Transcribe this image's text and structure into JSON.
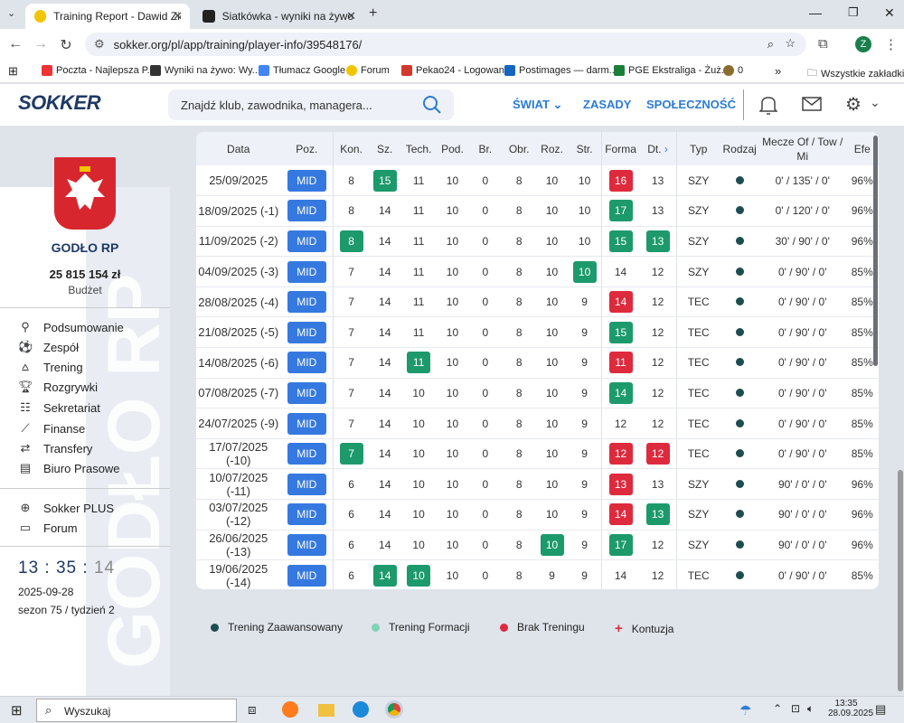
{
  "browser": {
    "tabs": [
      {
        "label": "Training Report - Dawid Ziemiar",
        "active": true
      },
      {
        "label": "Siatkówka - wyniki na żywo, wyn",
        "active": false
      }
    ],
    "url": "sokker.org/pl/app/training/player-info/39548176/",
    "bookmarks": [
      "Poczta - Najlepsza P...",
      "Wyniki na żywo: Wy...",
      "Tłumacz Google",
      "Forum",
      "Pekao24 - Logowanie",
      "Postimages — darm...",
      "PGE Ekstraliga - Żuż...",
      "0",
      "Wszystkie zakładki"
    ],
    "profile_initial": "Z"
  },
  "header": {
    "logo": "SOKKER",
    "search_placeholder": "Znajdź klub, zawodnika, managera...",
    "nav": [
      "ŚWIAT",
      "ZASADY",
      "SPOŁECZNOŚĆ"
    ]
  },
  "sidebar": {
    "club_name": "GODŁO RP",
    "budget": "25 815 154 zł",
    "budget_label": "Budżet",
    "menu": [
      "Podsumowanie",
      "Zespół",
      "Trening",
      "Rozgrywki",
      "Sekretariat",
      "Finanse",
      "Transfery",
      "Biuro Prasowe"
    ],
    "menu2": [
      "Sokker PLUS",
      "Forum"
    ],
    "clock": {
      "h": "13",
      "m": "35",
      "s": "14"
    },
    "date": "2025-09-28",
    "season": "sezon 75 / tydzień 2",
    "watermark": "GODŁO RP"
  },
  "table": {
    "headers": [
      "Data",
      "Poz.",
      "Kon.",
      "Sz.",
      "Tech.",
      "Pod.",
      "Br.",
      "Obr.",
      "Roz.",
      "Str.",
      "Forma",
      "Dt.",
      "Typ",
      "Rodzaj",
      "Mecze Of / Tow / Mi",
      "Efe"
    ],
    "rows": [
      {
        "date": "25/09/2025",
        "pos": "MID",
        "kon": "8",
        "sz": "15",
        "tech": "11",
        "pod": "10",
        "br": "0",
        "obr": "8",
        "roz": "10",
        "str": "10",
        "forma": "16",
        "dt": "13",
        "typ": "SZY",
        "mecze": "0' / 135' / 0'",
        "efe": "96%",
        "hl": {
          "sz": "g",
          "forma": "r"
        }
      },
      {
        "date": "18/09/2025 (-1)",
        "pos": "MID",
        "kon": "8",
        "sz": "14",
        "tech": "11",
        "pod": "10",
        "br": "0",
        "obr": "8",
        "roz": "10",
        "str": "10",
        "forma": "17",
        "dt": "13",
        "typ": "SZY",
        "mecze": "0' / 120' / 0'",
        "efe": "96%",
        "hl": {
          "forma": "g"
        }
      },
      {
        "date": "11/09/2025 (-2)",
        "pos": "MID",
        "kon": "8",
        "sz": "14",
        "tech": "11",
        "pod": "10",
        "br": "0",
        "obr": "8",
        "roz": "10",
        "str": "10",
        "forma": "15",
        "dt": "13",
        "typ": "SZY",
        "mecze": "30' / 90' / 0'",
        "efe": "96%",
        "hl": {
          "kon": "g",
          "forma": "g",
          "dt": "g"
        }
      },
      {
        "date": "04/09/2025 (-3)",
        "pos": "MID",
        "kon": "7",
        "sz": "14",
        "tech": "11",
        "pod": "10",
        "br": "0",
        "obr": "8",
        "roz": "10",
        "str": "10",
        "forma": "14",
        "dt": "12",
        "typ": "SZY",
        "mecze": "0' / 90' / 0'",
        "efe": "85%",
        "hl": {
          "str": "g"
        }
      },
      {
        "date": "28/08/2025 (-4)",
        "pos": "MID",
        "kon": "7",
        "sz": "14",
        "tech": "11",
        "pod": "10",
        "br": "0",
        "obr": "8",
        "roz": "10",
        "str": "9",
        "forma": "14",
        "dt": "12",
        "typ": "TEC",
        "mecze": "0' / 90' / 0'",
        "efe": "85%",
        "hl": {
          "forma": "r"
        }
      },
      {
        "date": "21/08/2025 (-5)",
        "pos": "MID",
        "kon": "7",
        "sz": "14",
        "tech": "11",
        "pod": "10",
        "br": "0",
        "obr": "8",
        "roz": "10",
        "str": "9",
        "forma": "15",
        "dt": "12",
        "typ": "TEC",
        "mecze": "0' / 90' / 0'",
        "efe": "85%",
        "hl": {
          "forma": "g"
        }
      },
      {
        "date": "14/08/2025 (-6)",
        "pos": "MID",
        "kon": "7",
        "sz": "14",
        "tech": "11",
        "pod": "10",
        "br": "0",
        "obr": "8",
        "roz": "10",
        "str": "9",
        "forma": "11",
        "dt": "12",
        "typ": "TEC",
        "mecze": "0' / 90' / 0'",
        "efe": "85%",
        "hl": {
          "tech": "g",
          "forma": "r"
        }
      },
      {
        "date": "07/08/2025 (-7)",
        "pos": "MID",
        "kon": "7",
        "sz": "14",
        "tech": "10",
        "pod": "10",
        "br": "0",
        "obr": "8",
        "roz": "10",
        "str": "9",
        "forma": "14",
        "dt": "12",
        "typ": "TEC",
        "mecze": "0' / 90' / 0'",
        "efe": "85%",
        "hl": {
          "forma": "g"
        }
      },
      {
        "date": "24/07/2025 (-9)",
        "pos": "MID",
        "kon": "7",
        "sz": "14",
        "tech": "10",
        "pod": "10",
        "br": "0",
        "obr": "8",
        "roz": "10",
        "str": "9",
        "forma": "12",
        "dt": "12",
        "typ": "TEC",
        "mecze": "0' / 90' / 0'",
        "efe": "85%",
        "hl": {}
      },
      {
        "date": "17/07/2025 (-10)",
        "pos": "MID",
        "kon": "7",
        "sz": "14",
        "tech": "10",
        "pod": "10",
        "br": "0",
        "obr": "8",
        "roz": "10",
        "str": "9",
        "forma": "12",
        "dt": "12",
        "typ": "TEC",
        "mecze": "0' / 90' / 0'",
        "efe": "85%",
        "hl": {
          "kon": "g",
          "forma": "r",
          "dt": "r"
        }
      },
      {
        "date": "10/07/2025 (-11)",
        "pos": "MID",
        "kon": "6",
        "sz": "14",
        "tech": "10",
        "pod": "10",
        "br": "0",
        "obr": "8",
        "roz": "10",
        "str": "9",
        "forma": "13",
        "dt": "13",
        "typ": "SZY",
        "mecze": "90' / 0' / 0'",
        "efe": "96%",
        "hl": {
          "forma": "r"
        }
      },
      {
        "date": "03/07/2025 (-12)",
        "pos": "MID",
        "kon": "6",
        "sz": "14",
        "tech": "10",
        "pod": "10",
        "br": "0",
        "obr": "8",
        "roz": "10",
        "str": "9",
        "forma": "14",
        "dt": "13",
        "typ": "SZY",
        "mecze": "90' / 0' / 0'",
        "efe": "96%",
        "hl": {
          "forma": "r",
          "dt": "g"
        }
      },
      {
        "date": "26/06/2025 (-13)",
        "pos": "MID",
        "kon": "6",
        "sz": "14",
        "tech": "10",
        "pod": "10",
        "br": "0",
        "obr": "8",
        "roz": "10",
        "str": "9",
        "forma": "17",
        "dt": "12",
        "typ": "SZY",
        "mecze": "90' / 0' / 0'",
        "efe": "96%",
        "hl": {
          "roz": "g",
          "forma": "g"
        }
      },
      {
        "date": "19/06/2025 (-14)",
        "pos": "MID",
        "kon": "6",
        "sz": "14",
        "tech": "10",
        "pod": "10",
        "br": "0",
        "obr": "8",
        "roz": "9",
        "str": "9",
        "forma": "14",
        "dt": "12",
        "typ": "TEC",
        "mecze": "0' / 90' / 0'",
        "efe": "85%",
        "hl": {
          "sz": "g",
          "tech": "g"
        }
      }
    ]
  },
  "legend": [
    {
      "label": "Trening Zaawansowany",
      "color": "#1d4d4f",
      "mark": "dot"
    },
    {
      "label": "Trening Formacji",
      "color": "#7fd3b5",
      "mark": "dot"
    },
    {
      "label": "Brak Treningu",
      "color": "#de2a3d",
      "mark": "dot"
    },
    {
      "label": "Kontuzja",
      "color": "#de2a3d",
      "mark": "+"
    }
  ],
  "taskbar": {
    "search_placeholder": "Wyszukaj",
    "time": "13:35",
    "date": "28.09.2025"
  },
  "colors": {
    "accent": "#2b7bd6",
    "position_badge": "#3579e0",
    "increase": "#1d9a6c",
    "decrease": "#de2a3d",
    "brand": "#1e3a64"
  }
}
